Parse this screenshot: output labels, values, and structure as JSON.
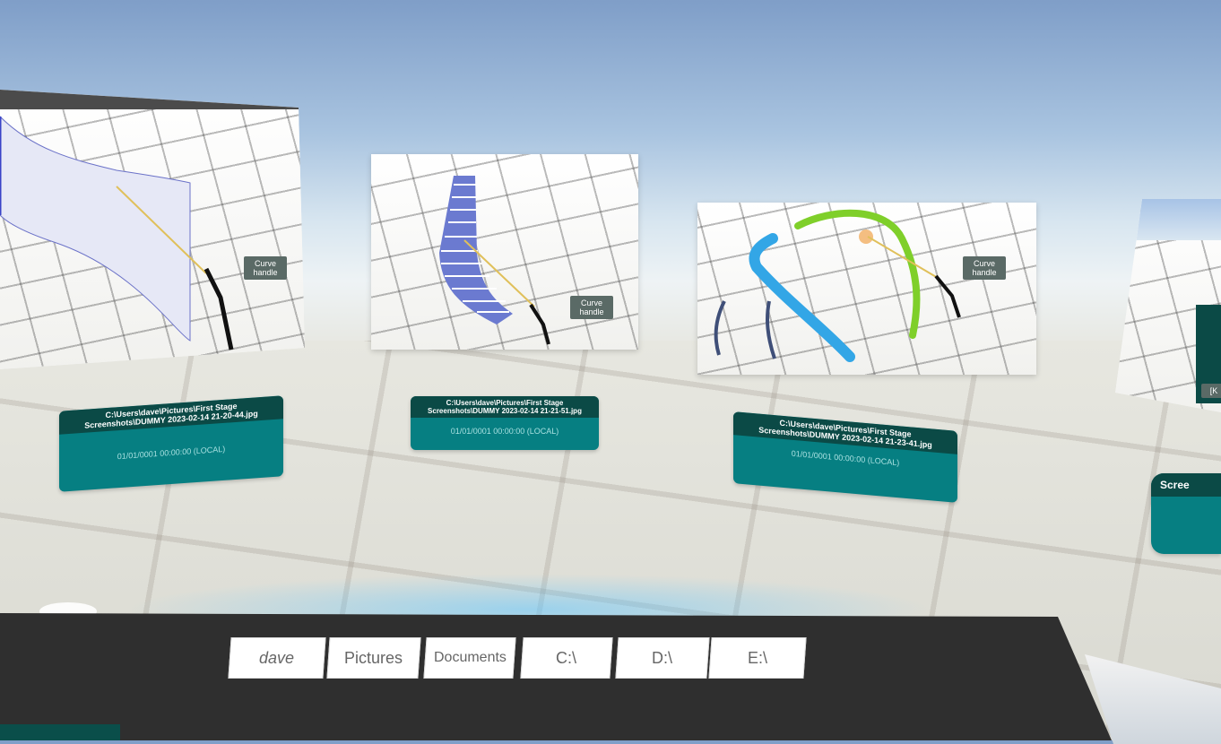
{
  "gallery": {
    "items": [
      {
        "path": "C:\\Users\\dave\\Pictures\\First Stage Screenshots\\DUMMY 2023-02-14 21-20-44.jpg",
        "date": "01/01/0001 00:00:00 (LOCAL)",
        "tag": "Curve handle"
      },
      {
        "path": "C:\\Users\\dave\\Pictures\\First Stage Screenshots\\DUMMY 2023-02-14 21-21-51.jpg",
        "date": "01/01/0001 00:00:00 (LOCAL)",
        "tag": "Curve handle"
      },
      {
        "path": "C:\\Users\\dave\\Pictures\\First Stage Screenshots\\DUMMY 2023-02-14 21-23-41.jpg",
        "date": "01/01/0001 00:00:00 (LOCAL)",
        "tag": "Curve handle"
      },
      {
        "path": "Scree",
        "thumb_label": "[K"
      }
    ]
  },
  "breadcrumbs": [
    "dave",
    "Pictures",
    "Documents",
    "C:\\",
    "D:\\",
    "E:\\"
  ]
}
